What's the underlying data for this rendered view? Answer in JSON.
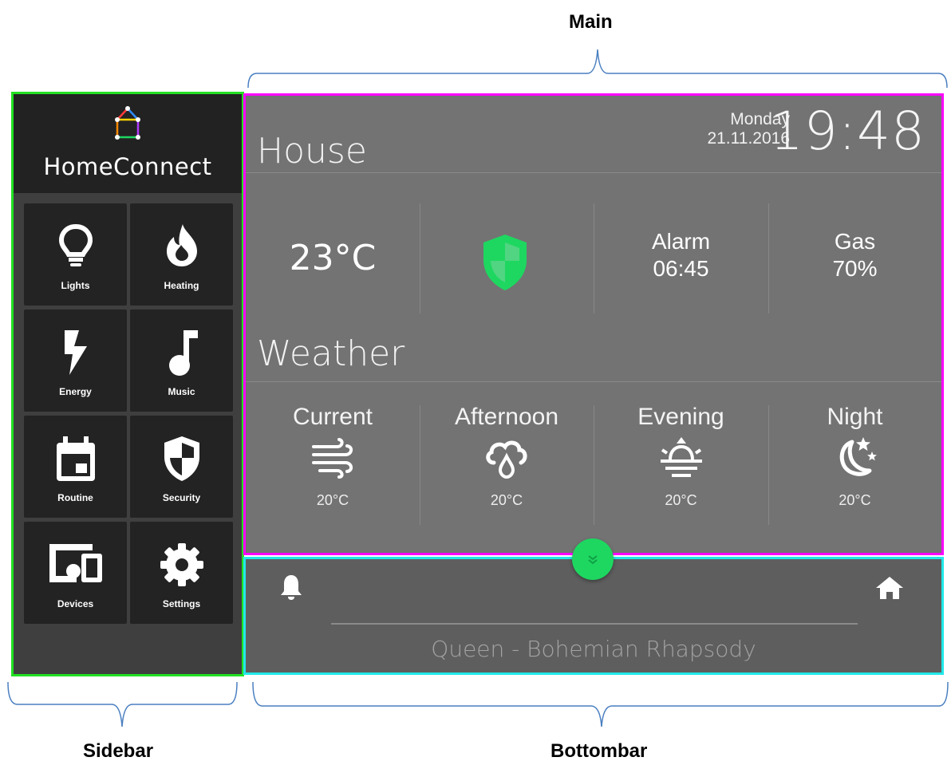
{
  "annotations": {
    "main": "Main",
    "sidebar": "Sidebar",
    "bottombar": "Bottombar"
  },
  "sidebar": {
    "brand": "HomeConnect",
    "items": [
      {
        "label": "Lights",
        "icon": "lightbulb-icon"
      },
      {
        "label": "Heating",
        "icon": "flame-icon"
      },
      {
        "label": "Energy",
        "icon": "bolt-icon"
      },
      {
        "label": "Music",
        "icon": "music-note-icon"
      },
      {
        "label": "Routine",
        "icon": "calendar-icon"
      },
      {
        "label": "Security",
        "icon": "shield-icon"
      },
      {
        "label": "Devices",
        "icon": "devices-icon"
      },
      {
        "label": "Settings",
        "icon": "gear-icon"
      }
    ]
  },
  "main": {
    "house_title": "House",
    "day": "Monday",
    "date": "21.11.2016",
    "time": "19:48",
    "temperature": "23°C",
    "security_icon": "shield-icon",
    "alarm_label": "Alarm",
    "alarm_time": "06:45",
    "gas_label": "Gas",
    "gas_value": "70%",
    "weather_title": "Weather",
    "weather": [
      {
        "name": "Current",
        "icon": "wind-icon",
        "temp": "20°C"
      },
      {
        "name": "Afternoon",
        "icon": "rain-cloud-icon",
        "temp": "20°C"
      },
      {
        "name": "Evening",
        "icon": "sunset-icon",
        "temp": "20°C"
      },
      {
        "name": "Night",
        "icon": "moon-stars-icon",
        "temp": "20°C"
      }
    ]
  },
  "bottombar": {
    "song": "Queen - Bohemian Rhapsody",
    "left_icon": "bell-icon",
    "right_icon": "home-icon"
  },
  "colors": {
    "sidebar_outline": "#22e022",
    "main_outline": "#ff00ff",
    "bottombar_outline": "#22e8e8",
    "accent_green": "#1ed760"
  }
}
